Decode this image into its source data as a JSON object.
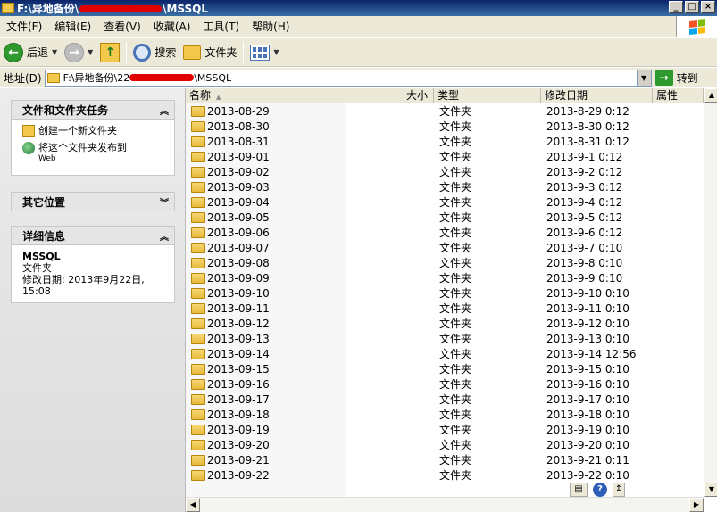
{
  "window": {
    "title_prefix": "F:\\异地备份\\",
    "title_suffix": "\\MSSQL",
    "min_label": "_",
    "max_label": "□",
    "close_label": "×"
  },
  "menu": {
    "items": [
      "文件(F)",
      "编辑(E)",
      "查看(V)",
      "收藏(A)",
      "工具(T)",
      "帮助(H)"
    ]
  },
  "toolbar": {
    "back_label": "后退",
    "search_label": "搜索",
    "folders_label": "文件夹"
  },
  "address": {
    "label": "地址(D)",
    "path_prefix": "F:\\异地备份\\22",
    "path_suffix": "\\MSSQL",
    "go_label": "转到"
  },
  "taskpane": {
    "file_tasks": {
      "title": "文件和文件夹任务",
      "create_folder": "创建一个新文件夹",
      "publish": "将这个文件夹发布到",
      "publish_sub": "Web"
    },
    "other_places": {
      "title": "其它位置"
    },
    "details": {
      "title": "详细信息",
      "name": "MSSQL",
      "type": "文件夹",
      "modified_label": "修改日期: 2013年9月22日,",
      "modified_time": "15:08"
    }
  },
  "columns": {
    "name": "名称",
    "size": "大小",
    "type": "类型",
    "date": "修改日期",
    "attr": "属性"
  },
  "files": [
    {
      "name": "2013-08-29",
      "type": "文件夹",
      "date": "2013-8-29 0:12"
    },
    {
      "name": "2013-08-30",
      "type": "文件夹",
      "date": "2013-8-30 0:12"
    },
    {
      "name": "2013-08-31",
      "type": "文件夹",
      "date": "2013-8-31 0:12"
    },
    {
      "name": "2013-09-01",
      "type": "文件夹",
      "date": "2013-9-1 0:12"
    },
    {
      "name": "2013-09-02",
      "type": "文件夹",
      "date": "2013-9-2 0:12"
    },
    {
      "name": "2013-09-03",
      "type": "文件夹",
      "date": "2013-9-3 0:12"
    },
    {
      "name": "2013-09-04",
      "type": "文件夹",
      "date": "2013-9-4 0:12"
    },
    {
      "name": "2013-09-05",
      "type": "文件夹",
      "date": "2013-9-5 0:12"
    },
    {
      "name": "2013-09-06",
      "type": "文件夹",
      "date": "2013-9-6 0:12"
    },
    {
      "name": "2013-09-07",
      "type": "文件夹",
      "date": "2013-9-7 0:10"
    },
    {
      "name": "2013-09-08",
      "type": "文件夹",
      "date": "2013-9-8 0:10"
    },
    {
      "name": "2013-09-09",
      "type": "文件夹",
      "date": "2013-9-9 0:10"
    },
    {
      "name": "2013-09-10",
      "type": "文件夹",
      "date": "2013-9-10 0:10"
    },
    {
      "name": "2013-09-11",
      "type": "文件夹",
      "date": "2013-9-11 0:10"
    },
    {
      "name": "2013-09-12",
      "type": "文件夹",
      "date": "2013-9-12 0:10"
    },
    {
      "name": "2013-09-13",
      "type": "文件夹",
      "date": "2013-9-13 0:10"
    },
    {
      "name": "2013-09-14",
      "type": "文件夹",
      "date": "2013-9-14 12:56"
    },
    {
      "name": "2013-09-15",
      "type": "文件夹",
      "date": "2013-9-15 0:10"
    },
    {
      "name": "2013-09-16",
      "type": "文件夹",
      "date": "2013-9-16 0:10"
    },
    {
      "name": "2013-09-17",
      "type": "文件夹",
      "date": "2013-9-17 0:10"
    },
    {
      "name": "2013-09-18",
      "type": "文件夹",
      "date": "2013-9-18 0:10"
    },
    {
      "name": "2013-09-19",
      "type": "文件夹",
      "date": "2013-9-19 0:10"
    },
    {
      "name": "2013-09-20",
      "type": "文件夹",
      "date": "2013-9-20 0:10"
    },
    {
      "name": "2013-09-21",
      "type": "文件夹",
      "date": "2013-9-21 0:11"
    },
    {
      "name": "2013-09-22",
      "type": "文件夹",
      "date": "2013-9-22 0:10"
    }
  ]
}
